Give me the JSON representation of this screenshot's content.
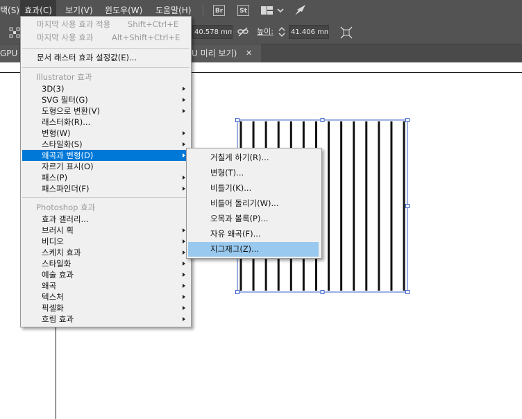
{
  "menubar": {
    "items": [
      "택(S)",
      "효과(C)",
      "보기(V)",
      "윈도우(W)",
      "도움말(H)"
    ],
    "badges": [
      "Br",
      "St"
    ]
  },
  "controlbar": {
    "width_value": "40.578 mm",
    "height_label": "높이:",
    "height_value": "41.406 mm"
  },
  "tabs": {
    "left": "GPU",
    "right": "U 미리 보기)",
    "close": "✕"
  },
  "effect_menu": {
    "top_items": [
      {
        "label": "마지막 사용 효과 적용",
        "shortcut": "Shift+Ctrl+E",
        "disabled": true
      },
      {
        "label": "마지막 사용 효과",
        "shortcut": "Alt+Shift+Ctrl+E",
        "disabled": true
      }
    ],
    "raster_settings": "문서 래스터 효과 설정값(E)...",
    "illustrator_header": "Illustrator 효과",
    "illustrator_items": [
      {
        "label": "3D(3)",
        "sub": true
      },
      {
        "label": "SVG 필터(G)",
        "sub": true
      },
      {
        "label": "도형으로 변환(V)",
        "sub": true
      },
      {
        "label": "래스터화(R)...",
        "sub": false
      },
      {
        "label": "변형(W)",
        "sub": true
      },
      {
        "label": "스타일화(S)",
        "sub": true
      },
      {
        "label": "왜곡과 변형(D)",
        "sub": true,
        "highlighted": true
      },
      {
        "label": "자르기 표시(O)",
        "sub": false
      },
      {
        "label": "패스(P)",
        "sub": true
      },
      {
        "label": "패스파인더(F)",
        "sub": true
      }
    ],
    "photoshop_header": "Photoshop 효과",
    "photoshop_items": [
      {
        "label": "효과 갤러리...",
        "sub": false
      },
      {
        "label": "브러시 획",
        "sub": true
      },
      {
        "label": "비디오",
        "sub": true
      },
      {
        "label": "스케치 효과",
        "sub": true
      },
      {
        "label": "스타일화",
        "sub": true
      },
      {
        "label": "예술 효과",
        "sub": true
      },
      {
        "label": "왜곡",
        "sub": true
      },
      {
        "label": "텍스처",
        "sub": true
      },
      {
        "label": "픽셀화",
        "sub": true
      },
      {
        "label": "흐림 효과",
        "sub": true
      }
    ]
  },
  "distort_submenu": {
    "items": [
      {
        "label": "거칠게 하기(R)..."
      },
      {
        "label": "변형(T)..."
      },
      {
        "label": "비틀기(K)..."
      },
      {
        "label": "비틀어 돌리기(W)..."
      },
      {
        "label": "오목과 볼록(P)..."
      },
      {
        "label": "자유 왜곡(F)..."
      },
      {
        "label": "지그재그(Z)...",
        "highlighted": true
      }
    ]
  },
  "artwork": {
    "stripe_count": 14,
    "selection_color": "#3a5fcd"
  },
  "colors": {
    "chrome": "#535353",
    "menu_bg": "#f0f0f0",
    "highlight": "#0078d7",
    "hover": "#99c9ef"
  }
}
